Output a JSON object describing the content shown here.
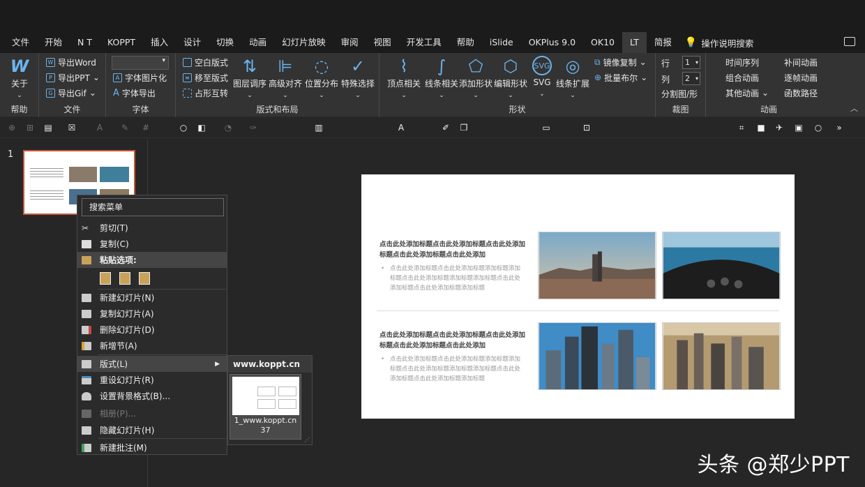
{
  "tabs": [
    "文件",
    "开始",
    "N T",
    "KOPPT",
    "插入",
    "设计",
    "切换",
    "动画",
    "幻灯片放映",
    "审阅",
    "视图",
    "开发工具",
    "帮助",
    "iSlide",
    "OKPlus 9.0",
    "OK10",
    "LT",
    "简报"
  ],
  "active_tab": "LT",
  "tell_me": "操作说明搜索",
  "ribbon": {
    "help": {
      "label": "帮助",
      "btn": "关于"
    },
    "file": {
      "label": "文件",
      "export_word": "导出Word",
      "export_ppt": "导出PPT",
      "export_gif": "导出Gif"
    },
    "font": {
      "label": "字体",
      "font_img": "字体图片化",
      "font_export": "字体导出"
    },
    "layout": {
      "label": "版式和布局",
      "blank": "空白版式",
      "move_to": "移至版式",
      "grid": "占形互转",
      "layer": "图层调序",
      "align": "高级对齐",
      "distribute": "位置分布",
      "select": "特殊选择"
    },
    "shape": {
      "label": "形状",
      "vertex": "顶点相关",
      "line": "线条相关",
      "add_shape": "添加形状",
      "edit_shape": "编辑形状",
      "svg": "SVG",
      "line_ext": "线条扩展",
      "mirror": "镜像复制",
      "boolean": "批量布尔"
    },
    "crop": {
      "label": "裁图",
      "row": "行",
      "row_val": "1",
      "col": "列",
      "col_val": "2",
      "split": "分割图/形"
    },
    "anim": {
      "label": "动画",
      "timeline": "时间序列",
      "tween": "补间动画",
      "combine": "组合动画",
      "frame": "逐帧动画",
      "other": "其他动画",
      "path": "函数路径"
    }
  },
  "slide_number": "1",
  "slide": {
    "title1": "点击此处添加标题点击此处添加标题点击此处添加标题点击此处添加标题点击此处添加",
    "body1": "点击此处添加标题点击此处添加标题添加标题添加标题点击此处添加标题添加标题添加标题点击此处添加标题点击此处添加标题添加标题",
    "title2": "点击此处添加标题点击此处添加标题点击此处添加标题点击此处添加标题点击此处添加",
    "body2": "点击此处添加标题点击此处添加标题添加标题添加标题点击此处添加标题添加标题添加标题点击此处添加标题点击此处添加标题添加标题"
  },
  "context_menu": {
    "search": "搜索菜单",
    "cut": "剪切(T)",
    "copy": "复制(C)",
    "paste_options": "粘贴选项:",
    "new_slide": "新建幻灯片(N)",
    "dup_slide": "复制幻灯片(A)",
    "del_slide": "删除幻灯片(D)",
    "add_section": "新增节(A)",
    "layout": "版式(L)",
    "reset_slide": "重设幻灯片(R)",
    "bg_format": "设置背景格式(B)...",
    "album": "相册(P)...",
    "hide_slide": "隐藏幻灯片(H)",
    "new_comment": "新建批注(M)"
  },
  "submenu": {
    "header": "www.koppt.cn",
    "layout_name": "1_www.koppt.cn 37"
  },
  "watermark": "头条 @郑少PPT",
  "colors": {
    "accent": "#6cb4ee",
    "thumb_border": "#c55a3a"
  }
}
